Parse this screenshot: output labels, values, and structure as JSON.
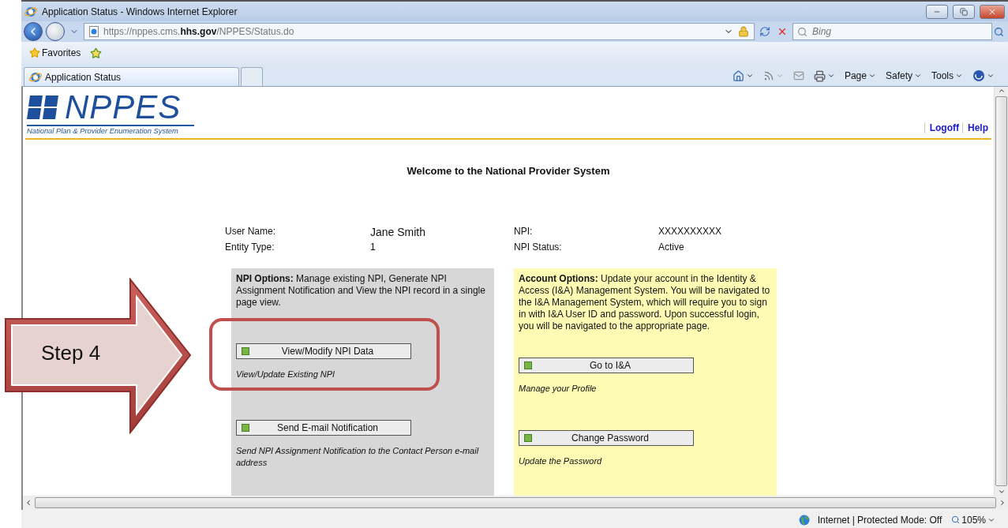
{
  "window": {
    "title": "Application Status - Windows Internet Explorer"
  },
  "address_bar": {
    "url": "https://nppes.cms.**hhs.gov**/NPPES/Status.do"
  },
  "search": {
    "placeholder": "Bing"
  },
  "favorites_bar": {
    "label": "Favorites"
  },
  "tabs": [
    {
      "label": "Application Status",
      "selected": true
    }
  ],
  "command_bar": [
    "Page",
    "Safety",
    "Tools"
  ],
  "page": {
    "logo": {
      "text": "NPPES",
      "subtitle": "National Plan & Provider Enumeration System"
    },
    "links": [
      "Logoff",
      "Help"
    ],
    "heading": "Welcome to the National Provider System",
    "fields": [
      {
        "label": "User Name:",
        "value": "Jane Smith"
      },
      {
        "label": "NPI:",
        "value": "XXXXXXXXXX"
      },
      {
        "label": "Entity Type:",
        "value": "1"
      },
      {
        "label": "NPI Status:",
        "value": "Active"
      }
    ],
    "panels": [
      {
        "kind": "grey",
        "title": "NPI Options:",
        "text": "Manage existing NPI, Generate NPI Assignment Notification and View the NPI record in a single page view.",
        "actions": [
          {
            "button": "View/Modify NPI Data",
            "note": "View/Update Existing NPI"
          },
          {
            "button": "Send E-mail Notification",
            "note": "Send NPI Assignment Notification to the Contact Person e-mail address"
          }
        ]
      },
      {
        "kind": "yellow",
        "title": "Account Options:",
        "text": "Update your account in the Identity & Access (I&A) Management System. You will be navigated to the I&A Management System, which will require you to sign in with I&A User ID and password. Upon successful login, you will be navigated to the appropriate page.",
        "actions": [
          {
            "button": "Go to I&A",
            "note": "Manage your Profile"
          },
          {
            "button": "Change Password",
            "note": "Update the Password"
          }
        ]
      }
    ]
  },
  "annotation": {
    "label": "Step 4"
  },
  "status_bar": {
    "zone": "Internet | Protected Mode: Off",
    "zoom": "105%"
  }
}
